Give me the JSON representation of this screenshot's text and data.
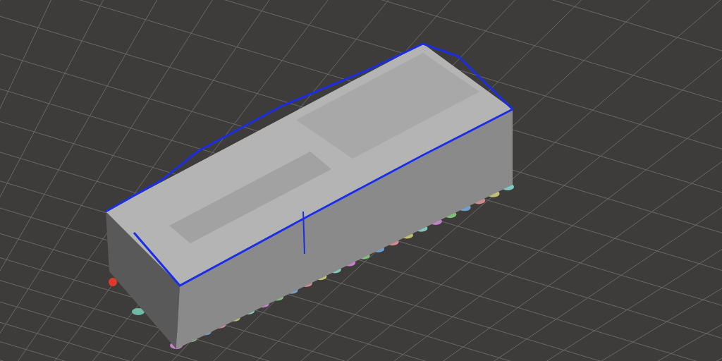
{
  "viewport": {
    "grid": true,
    "model": {
      "kind": "block",
      "supports": true
    }
  }
}
